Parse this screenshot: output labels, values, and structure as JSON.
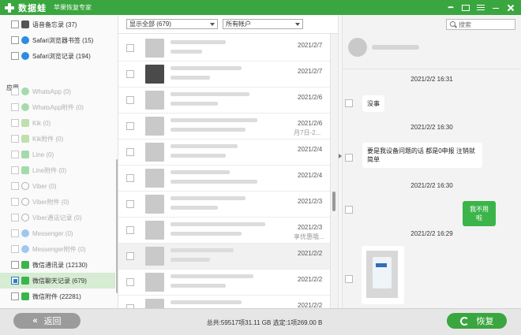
{
  "app": {
    "name": "数据蛙",
    "subtitle": "苹果恢复专家"
  },
  "sidebar": {
    "top_items": [
      {
        "label": "语音备忘录 (37)",
        "icon": "voice-memo-icon",
        "enabled": true
      },
      {
        "label": "Safari浏览器书签 (15)",
        "icon": "safari-bookmark-icon",
        "enabled": true
      },
      {
        "label": "Safari浏览记录 (194)",
        "icon": "safari-history-icon",
        "enabled": true
      }
    ],
    "section_title": "应用",
    "app_items": [
      {
        "label": "WhatsApp (0)",
        "icon": "whatsapp-icon",
        "enabled": false,
        "active": false
      },
      {
        "label": "WhatsApp附件 (0)",
        "icon": "whatsapp-icon",
        "enabled": false,
        "active": false
      },
      {
        "label": "Kik (0)",
        "icon": "kik-icon",
        "enabled": false,
        "active": false
      },
      {
        "label": "Kik附件 (0)",
        "icon": "kik-icon",
        "enabled": false,
        "active": false
      },
      {
        "label": "Line (0)",
        "icon": "line-icon",
        "enabled": false,
        "active": false
      },
      {
        "label": "Line附件 (0)",
        "icon": "line-icon",
        "enabled": false,
        "active": false
      },
      {
        "label": "Viber (0)",
        "icon": "viber-icon",
        "enabled": false,
        "active": false
      },
      {
        "label": "Viber附件 (0)",
        "icon": "viber-icon",
        "enabled": false,
        "active": false
      },
      {
        "label": "Viber通话记录 (0)",
        "icon": "viber-icon",
        "enabled": false,
        "active": false
      },
      {
        "label": "Messenger (0)",
        "icon": "messenger-icon",
        "enabled": false,
        "active": false
      },
      {
        "label": "Messenger附件 (0)",
        "icon": "messenger-icon",
        "enabled": false,
        "active": false
      },
      {
        "label": "微信通讯录 (12130)",
        "icon": "wechat-icon",
        "enabled": true,
        "active": false
      },
      {
        "label": "微信聊天记录 (679)",
        "icon": "wechat-icon",
        "enabled": true,
        "active": true
      },
      {
        "label": "微信附件 (22281)",
        "icon": "wechat-icon",
        "enabled": true,
        "active": false
      }
    ]
  },
  "filters": {
    "display": "显示全部 (679)",
    "account": "所有帐户"
  },
  "list": {
    "rows": [
      {
        "date": "2021/2/7",
        "avatar_dark": false,
        "alt": false,
        "extra": ""
      },
      {
        "date": "2021/2/7",
        "avatar_dark": true,
        "alt": false,
        "extra": ""
      },
      {
        "date": "2021/2/6",
        "avatar_dark": false,
        "alt": false,
        "extra": ""
      },
      {
        "date": "2021/2/6",
        "avatar_dark": false,
        "alt": false,
        "extra": "月7日-2..."
      },
      {
        "date": "2021/2/4",
        "avatar_dark": false,
        "alt": false,
        "extra": ""
      },
      {
        "date": "2021/2/4",
        "avatar_dark": false,
        "alt": false,
        "extra": ""
      },
      {
        "date": "2021/2/3",
        "avatar_dark": false,
        "alt": false,
        "extra": ""
      },
      {
        "date": "2021/2/3",
        "avatar_dark": false,
        "alt": false,
        "extra": "享优惠哦..."
      },
      {
        "date": "2021/2/2",
        "avatar_dark": false,
        "alt": true,
        "extra": ""
      },
      {
        "date": "2021/2/2",
        "avatar_dark": false,
        "alt": false,
        "extra": ""
      },
      {
        "date": "2021/2/2",
        "avatar_dark": false,
        "alt": false,
        "extra": ""
      }
    ]
  },
  "chat": {
    "search_placeholder": "搜索",
    "messages": [
      {
        "time": "2021/2/2 16:31",
        "text": "没事",
        "side": "left"
      },
      {
        "time": "2021/2/2 16:30",
        "text": "要是我设备问题的话 都是0申报 注销就简单",
        "side": "left"
      },
      {
        "time": "2021/2/2 16:30",
        "text": "我不用啦",
        "side": "right"
      },
      {
        "time": "2021/2/2 16:29",
        "text": "",
        "side": "left-image"
      }
    ]
  },
  "bottom": {
    "back_label": "返回",
    "back_icon": "double-chevron-left-icon",
    "stats": "总共:59517项31.11 GB 选定:1项269.00 B",
    "restore_label": "恢复",
    "restore_icon": "restore-icon"
  },
  "colors": {
    "brand_green": "#3aa63f",
    "active_row": "#d6ecd3",
    "back_button": "#9b9b9b"
  }
}
